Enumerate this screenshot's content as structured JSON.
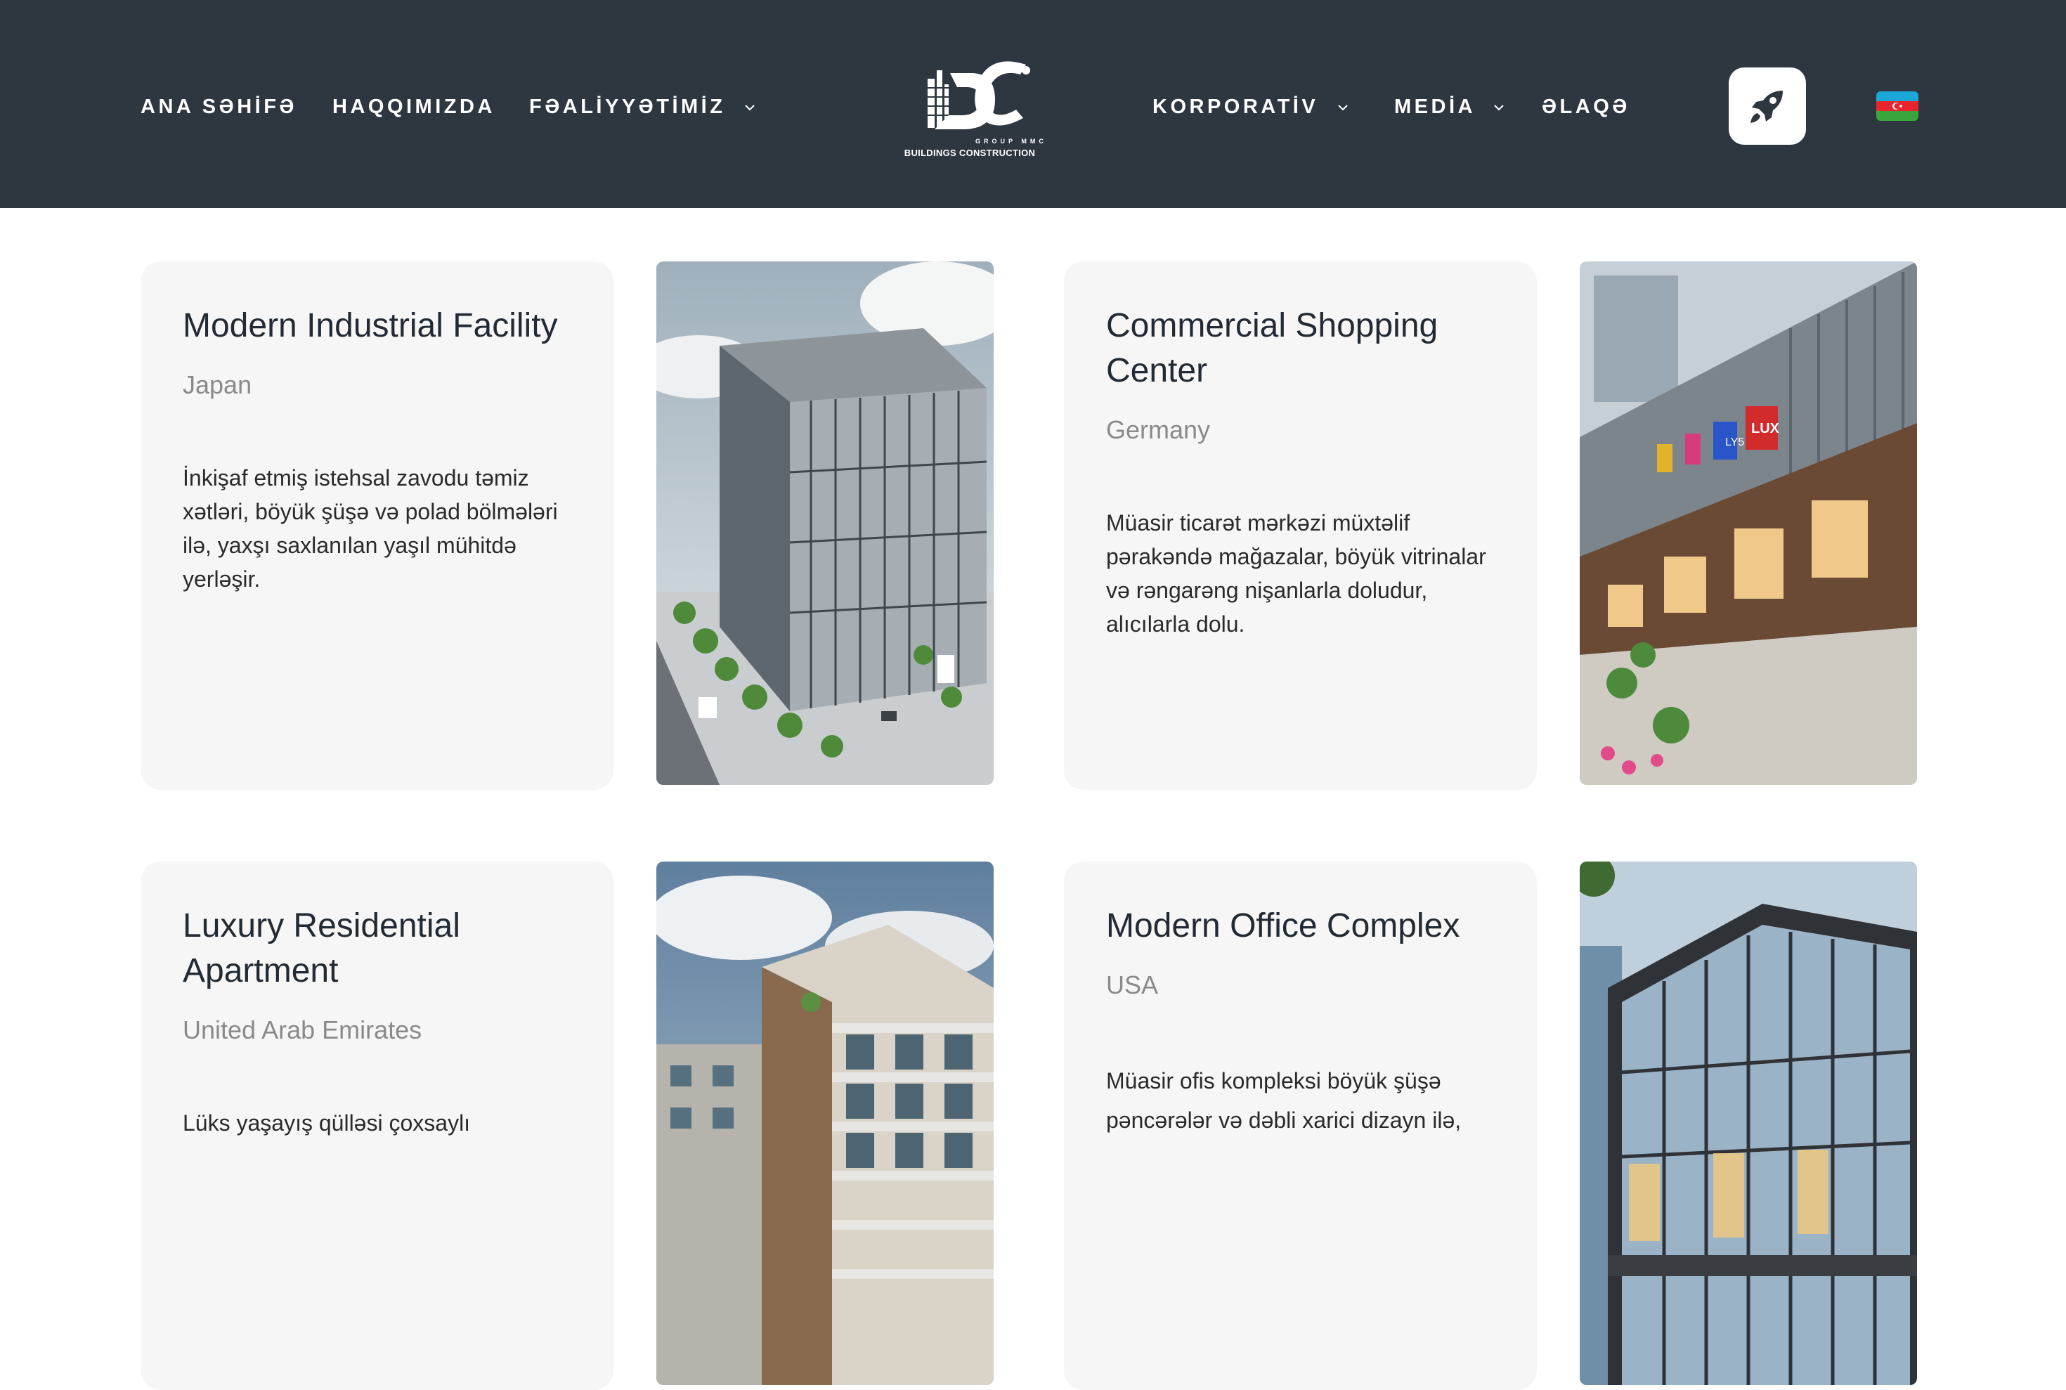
{
  "header": {
    "nav_left": [
      {
        "label": "ANA SƏHİFƏ"
      },
      {
        "label": "HAQQIMIZDA"
      },
      {
        "label": "FƏALİYYƏTİMİZ",
        "dropdown": true
      }
    ],
    "nav_right": [
      {
        "label": "KORPORATİV",
        "dropdown": true
      },
      {
        "label": "MEDİA",
        "dropdown": true
      },
      {
        "label": "ƏLAQƏ"
      }
    ],
    "logo": {
      "monogram": "DC",
      "group_text": "GROUP MMC",
      "caption": "BUILDINGS CONSTRUCTION"
    },
    "action_icon": "rocket-icon",
    "language_flag": "azerbaijan-flag"
  },
  "projects": [
    {
      "title": "Modern Industrial Facility",
      "country": "Japan",
      "description": " İnkişaf etmiş istehsal zavodu təmiz xətləri, böyük şüşə və polad bölmələri ilə, yaxşı saxlanılan yaşıl mühitdə yerləşir."
    },
    {
      "title": "Commercial Shopping Center",
      "country": "Germany",
      "description": "  Müasir ticarət mərkəzi müxtəlif pərakəndə mağazalar, böyük vitrinalar və rəngarəng nişanlarla doludur, alıcılarla dolu.",
      "sign_labels": [
        "LY5",
        "LUX"
      ]
    },
    {
      "title": "Luxury Residential Apartment",
      "country": "United Arab Emirates",
      "description": "Lüks yaşayış qülləsi çoxsaylı"
    },
    {
      "title": "Modern Office Complex",
      "country": "USA",
      "description": "Müasir ofis kompleksi böyük şüşə pəncərələr və dəbli xarici dizayn ilə,"
    }
  ],
  "colors": {
    "header_bg": "#2e3640",
    "card_bg": "#f6f6f6",
    "title_text": "#222a33",
    "country_text": "#8a8a8a"
  }
}
